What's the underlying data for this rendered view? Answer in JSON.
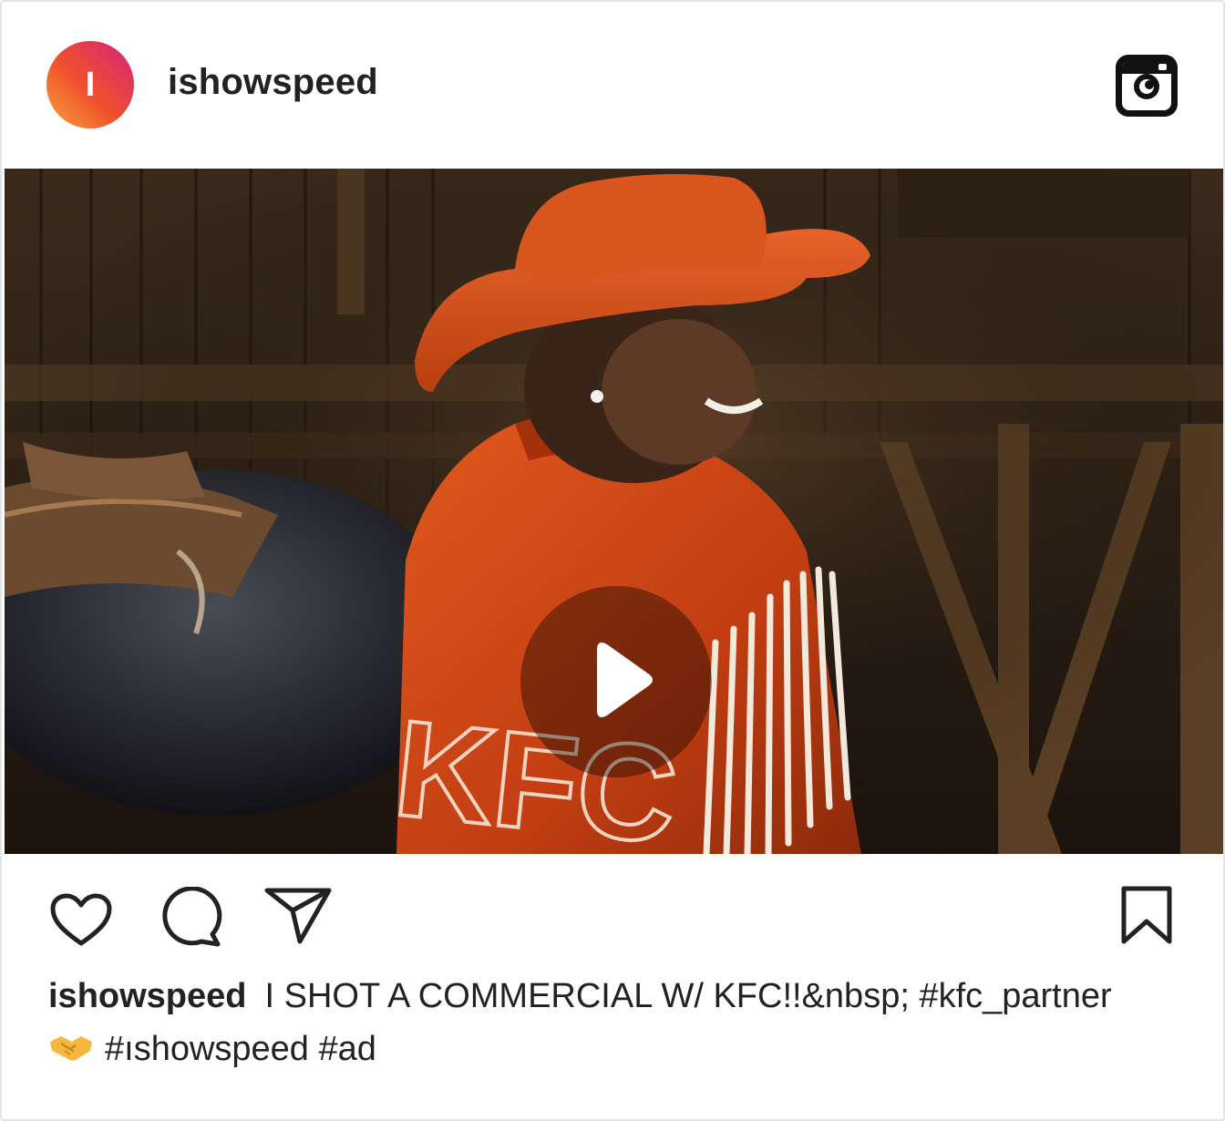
{
  "post": {
    "avatar_letter": "I",
    "username": "ishowspeed"
  },
  "media": {
    "jacket_text": "KFC"
  },
  "caption": {
    "username": "ishowspeed",
    "text_line1": "I SHOT A COMMERCIAL W/ KFC!!&nbsp; #kfc_partner",
    "emoji_icon": "handshake-emoji",
    "text_line2": "#ıshowspeed #ad"
  },
  "icons": {
    "header": "instagram-icon",
    "media": "play-icon",
    "actions": [
      "heart-icon",
      "comment-icon",
      "share-icon",
      "bookmark-icon"
    ]
  },
  "colors": {
    "avatar_gradient": [
      "#f7a23b",
      "#f0512d",
      "#d5237a"
    ],
    "text": "#222222",
    "border": "#e3e3e3"
  }
}
